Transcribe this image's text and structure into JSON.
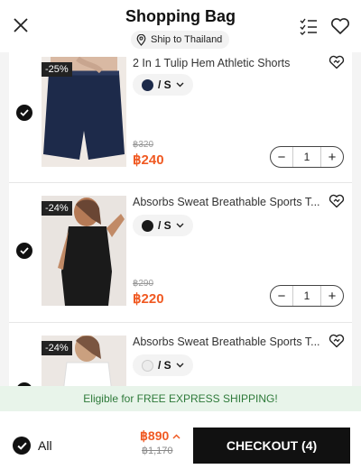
{
  "header": {
    "title": "Shopping Bag",
    "ship_to": "Ship to Thailand",
    "icons": [
      "close-icon",
      "location-pin-icon",
      "checklist-icon",
      "heart-icon"
    ]
  },
  "items": [
    {
      "discount": "-25%",
      "name": "2 In 1 Tulip Hem Athletic Shorts",
      "color": "#1d2a4a",
      "size": "/ S",
      "original_price": "฿320",
      "price": "฿240",
      "quantity": "1",
      "selected": true
    },
    {
      "discount": "-24%",
      "name": "Absorbs Sweat Breathable Sports T...",
      "color": "#1a1a1a",
      "size": "/ S",
      "original_price": "฿290",
      "price": "฿220",
      "quantity": "1",
      "selected": true
    },
    {
      "discount": "-24%",
      "name": "Absorbs Sweat Breathable Sports T...",
      "color": "#ececec",
      "size": "/ S",
      "selected": true
    }
  ],
  "shipping_banner": "Eligible for FREE EXPRESS SHIPPING!",
  "footer": {
    "all_label": "All",
    "total": "฿890",
    "total_original": "฿1,170",
    "checkout_label": "CHECKOUT (4)"
  },
  "colors": {
    "accent": "#f05a23",
    "banner_bg": "#e8f4ea",
    "banner_text": "#2e7a3a",
    "checkout_bg": "#111111"
  }
}
